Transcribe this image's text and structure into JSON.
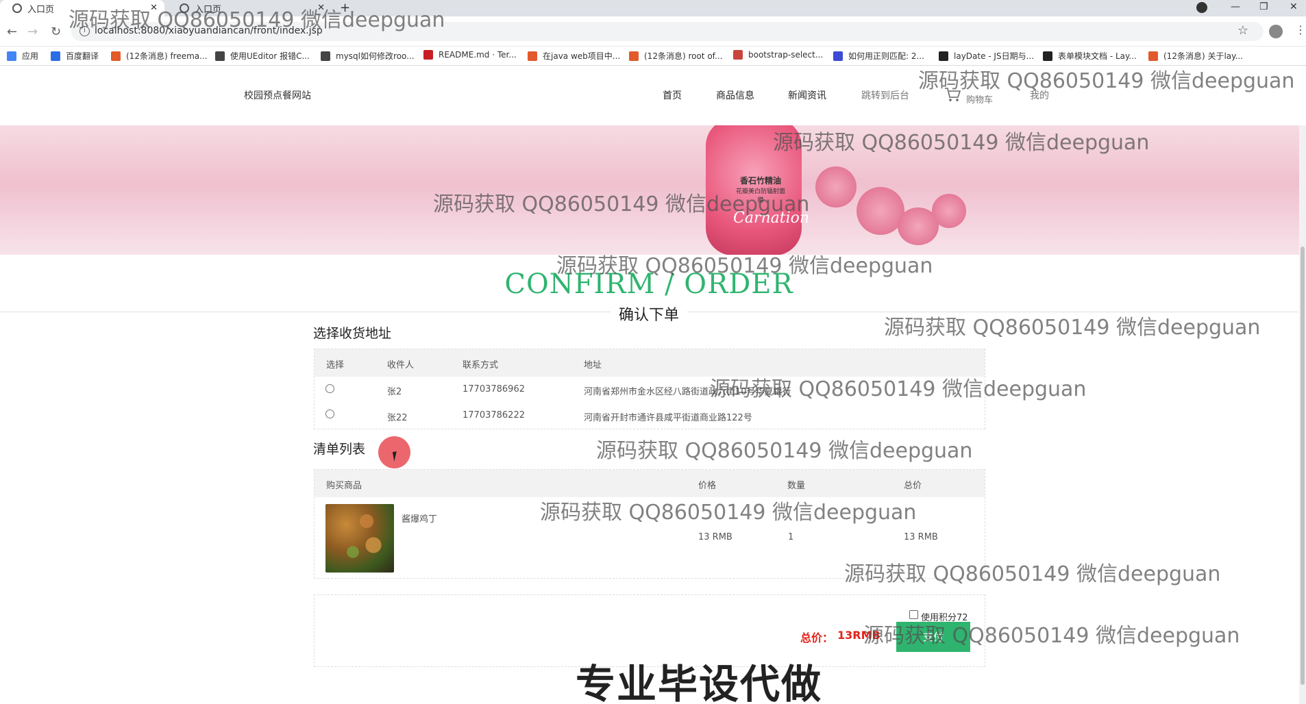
{
  "browser": {
    "tabs": [
      {
        "title": "入口页",
        "active": true
      },
      {
        "title": "入口页",
        "active": false
      }
    ],
    "new_tab": "+",
    "window_controls": [
      "—",
      "❐",
      "✕"
    ],
    "url": "localhost:8080/xiaoyuandiancan/front/index.jsp",
    "bookmarks": [
      {
        "label": "应用",
        "color": "#4285f4"
      },
      {
        "label": "百度翻译",
        "color": "#2b6de4"
      },
      {
        "label": "(12条消息) freema...",
        "color": "#e2592b"
      },
      {
        "label": "使用UEditor 报错C...",
        "color": "#444444"
      },
      {
        "label": "mysql如何修改roo...",
        "color": "#444444"
      },
      {
        "label": "README.md · Ter...",
        "color": "#c71d23"
      },
      {
        "label": "在java web项目中...",
        "color": "#e2592b"
      },
      {
        "label": "(12条消息) root of...",
        "color": "#e2592b"
      },
      {
        "label": "bootstrap-select...",
        "color": "#c9453c"
      },
      {
        "label": "如何用正则匹配: 2...",
        "color": "#3b4bd6"
      },
      {
        "label": "layDate - JS日期与...",
        "color": "#222222"
      },
      {
        "label": "表单模块文档 - Lay...",
        "color": "#222222"
      },
      {
        "label": "(12条消息) 关于lay...",
        "color": "#e2592b"
      }
    ]
  },
  "site": {
    "brand": "校园预点餐网站",
    "nav": [
      "首页",
      "商品信息",
      "新闻资讯",
      "跳转到后台",
      "购物车",
      "我的"
    ]
  },
  "banner": {
    "product_label": "香石竹精油",
    "product_sub": "花瓣美白防辐射面膜",
    "product_script": "Carnation"
  },
  "page": {
    "title_en": "CONFIRM / ORDER",
    "title_cn": "确认下单"
  },
  "address": {
    "heading": "选择收货地址",
    "columns": [
      "选择",
      "收件人",
      "联系方式",
      "地址"
    ],
    "rows": [
      {
        "name": "张2",
        "phone": "17703786962",
        "address": "河南省郑州市金水区经八路街道政六街10号华夏银行",
        "selected": false
      },
      {
        "name": "张22",
        "phone": "17703786222",
        "address": "河南省开封市通许县咸平街道商业路122号",
        "selected": false
      }
    ]
  },
  "cart": {
    "heading": "清单列表",
    "columns": [
      "购买商品",
      "价格",
      "数量",
      "总价"
    ],
    "items": [
      {
        "name": "酱爆鸡丁",
        "price": "13 RMB",
        "qty": "1",
        "total": "13 RMB"
      }
    ]
  },
  "summary": {
    "use_points_label": "使用积分72",
    "total_label": "总价：",
    "total_value": "13RMB",
    "pay_label": "支付"
  },
  "watermark": {
    "text": "源码获取 QQ86050149 微信deepguan",
    "footer": "专业毕设代做"
  }
}
